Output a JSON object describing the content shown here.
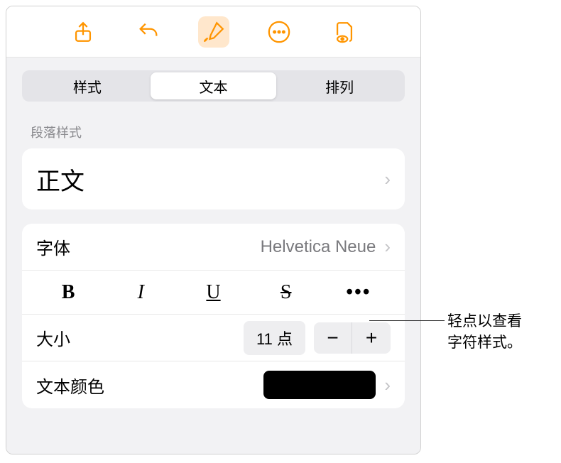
{
  "toolbar": {
    "icons": [
      "share",
      "undo",
      "brush",
      "more",
      "doc-eye"
    ]
  },
  "tabs": {
    "items": [
      "样式",
      "文本",
      "排列"
    ],
    "selectedIndex": 1
  },
  "paragraphStyle": {
    "label": "段落样式",
    "value": "正文"
  },
  "font": {
    "label": "字体",
    "value": "Helvetica Neue"
  },
  "styles": {
    "bold": "B",
    "italic": "I",
    "underline": "U",
    "strike": "S",
    "more": "•••"
  },
  "size": {
    "label": "大小",
    "value": "11 点",
    "minus": "−",
    "plus": "+"
  },
  "textColor": {
    "label": "文本颜色",
    "value": "#000000"
  },
  "callout": {
    "line1": "轻点以查看",
    "line2": "字符样式。"
  }
}
